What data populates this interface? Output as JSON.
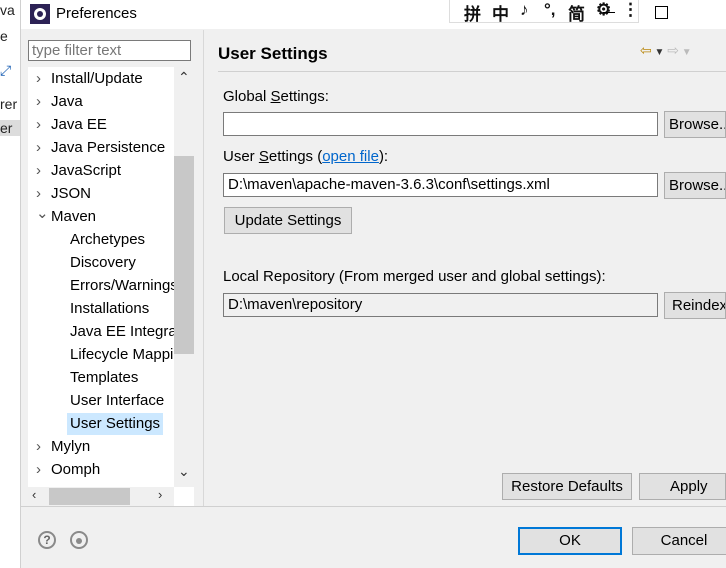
{
  "background_window": {
    "fragments": [
      "va",
      "e",
      "rer",
      "er"
    ]
  },
  "window": {
    "title": "Preferences"
  },
  "ime_toolbar": {
    "items": [
      "拼",
      "中",
      "♪",
      "°,",
      "简",
      "⚙",
      "⋮"
    ]
  },
  "filter": {
    "placeholder": "type filter text"
  },
  "tree": {
    "items": [
      {
        "label": "Install/Update",
        "level": 0,
        "expandable": true
      },
      {
        "label": "Java",
        "level": 0,
        "expandable": true
      },
      {
        "label": "Java EE",
        "level": 0,
        "expandable": true
      },
      {
        "label": "Java Persistence",
        "level": 0,
        "expandable": true
      },
      {
        "label": "JavaScript",
        "level": 0,
        "expandable": true
      },
      {
        "label": "JSON",
        "level": 0,
        "expandable": true
      },
      {
        "label": "Maven",
        "level": 0,
        "expanded": true
      },
      {
        "label": "Archetypes",
        "level": 1
      },
      {
        "label": "Discovery",
        "level": 1
      },
      {
        "label": "Errors/Warnings",
        "level": 1
      },
      {
        "label": "Installations",
        "level": 1
      },
      {
        "label": "Java EE Integration",
        "level": 1
      },
      {
        "label": "Lifecycle Mappings",
        "level": 1
      },
      {
        "label": "Templates",
        "level": 1
      },
      {
        "label": "User Interface",
        "level": 1
      },
      {
        "label": "User Settings",
        "level": 1,
        "selected": true
      },
      {
        "label": "Mylyn",
        "level": 0,
        "expandable": true
      },
      {
        "label": "Oomph",
        "level": 0,
        "expandable": true
      }
    ]
  },
  "page": {
    "title": "User Settings",
    "global_settings": {
      "label_pre": "Global ",
      "label_mn": "S",
      "label_post": "ettings:",
      "value": "",
      "browse": "Browse..."
    },
    "user_settings": {
      "label_pre": "User ",
      "label_mn": "S",
      "label_mid": "ettings (",
      "link": "open file",
      "label_post": "):",
      "value": "D:\\maven\\apache-maven-3.6.3\\conf\\settings.xml",
      "browse": "Browse..."
    },
    "update_button": "Update Settings",
    "local_repo": {
      "label": "Local Repository (From merged user and global settings):",
      "value": "D:\\maven\\repository",
      "reindex": "Reindex"
    },
    "restore_defaults": "Restore Defaults",
    "apply": "Apply"
  },
  "footer": {
    "ok": "OK",
    "cancel": "Cancel",
    "help_icon": "?"
  },
  "colors": {
    "selection": "#cce8ff",
    "link": "#0066cc",
    "nav_arrow": "#b8860b"
  }
}
